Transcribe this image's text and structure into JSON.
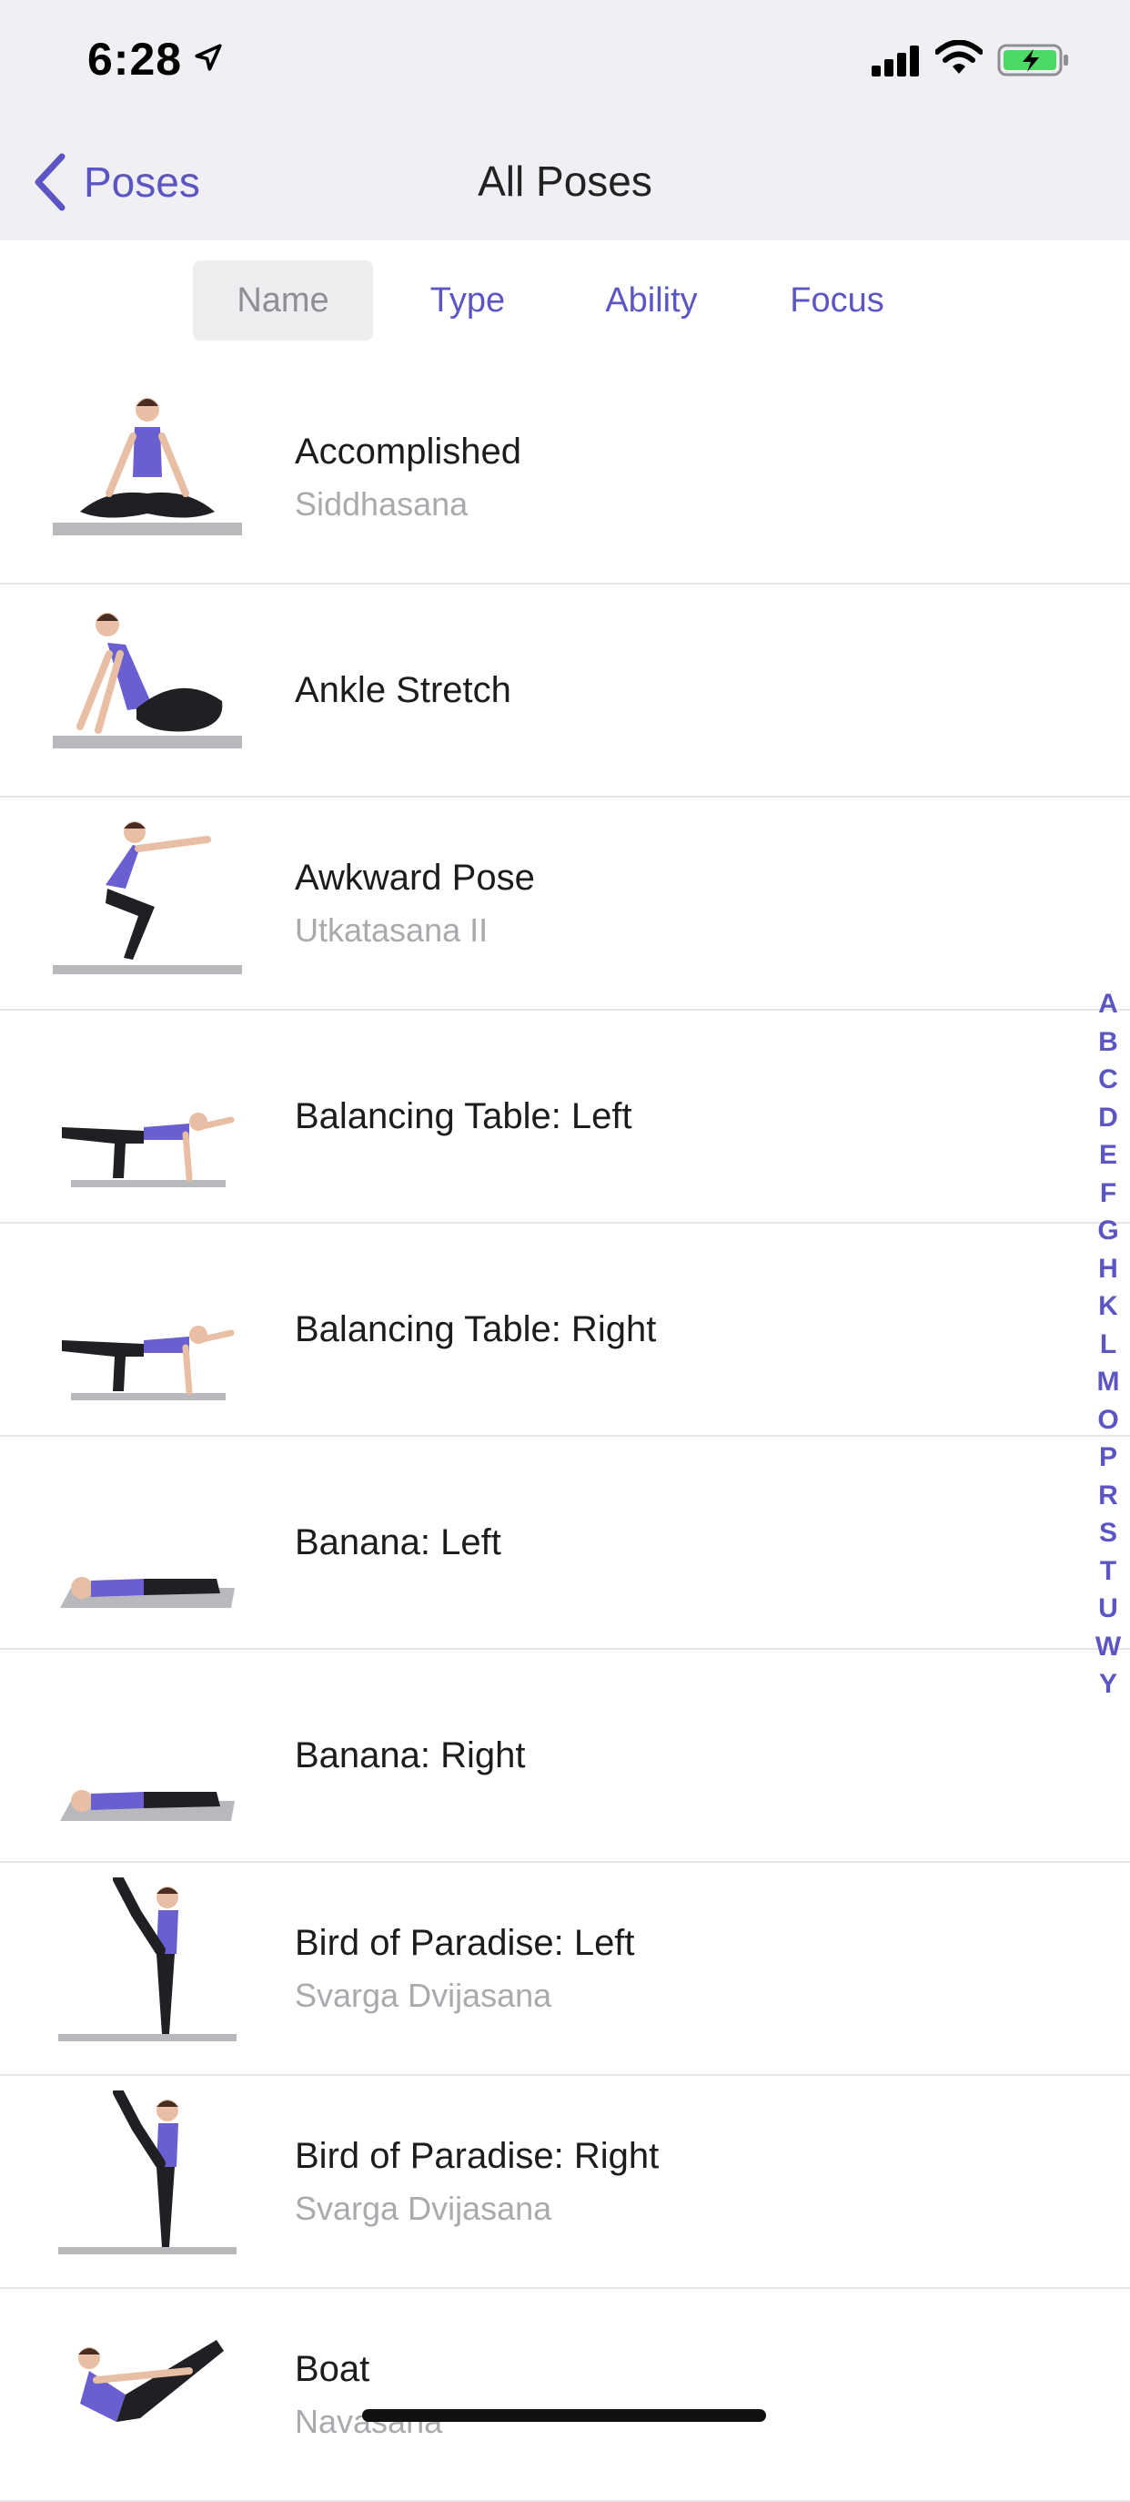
{
  "status": {
    "time": "6:28"
  },
  "nav": {
    "back_label": "Poses",
    "title": "All Poses"
  },
  "tabs": [
    {
      "label": "Name",
      "selected": true
    },
    {
      "label": "Type",
      "selected": false
    },
    {
      "label": "Ability",
      "selected": false
    },
    {
      "label": "Focus",
      "selected": false
    }
  ],
  "poses": [
    {
      "name": "Accomplished",
      "sanskrit": "Siddhasana",
      "figure": "seated"
    },
    {
      "name": "Ankle Stretch",
      "sanskrit": "",
      "figure": "kneel"
    },
    {
      "name": "Awkward Pose",
      "sanskrit": "Utkatasana II",
      "figure": "chair"
    },
    {
      "name": "Balancing Table: Left",
      "sanskrit": "",
      "figure": "table"
    },
    {
      "name": "Balancing Table: Right",
      "sanskrit": "",
      "figure": "table"
    },
    {
      "name": "Banana: Left",
      "sanskrit": "",
      "figure": "lying"
    },
    {
      "name": "Banana: Right",
      "sanskrit": "",
      "figure": "lying"
    },
    {
      "name": "Bird of Paradise: Left",
      "sanskrit": "Svarga Dvijasana",
      "figure": "standing"
    },
    {
      "name": "Bird of Paradise: Right",
      "sanskrit": "Svarga Dvijasana",
      "figure": "standing"
    },
    {
      "name": "Boat",
      "sanskrit": "Navasana",
      "figure": "boat"
    }
  ],
  "index_letters": [
    "A",
    "B",
    "C",
    "D",
    "E",
    "F",
    "G",
    "H",
    "K",
    "L",
    "M",
    "O",
    "P",
    "R",
    "S",
    "T",
    "U",
    "W",
    "Y"
  ],
  "colors": {
    "accent": "#5b56c4",
    "nav_bg": "#efeff4",
    "top_color": "#6a5fd0",
    "pants": "#1f1f24",
    "mat": "#b9b9bd"
  }
}
